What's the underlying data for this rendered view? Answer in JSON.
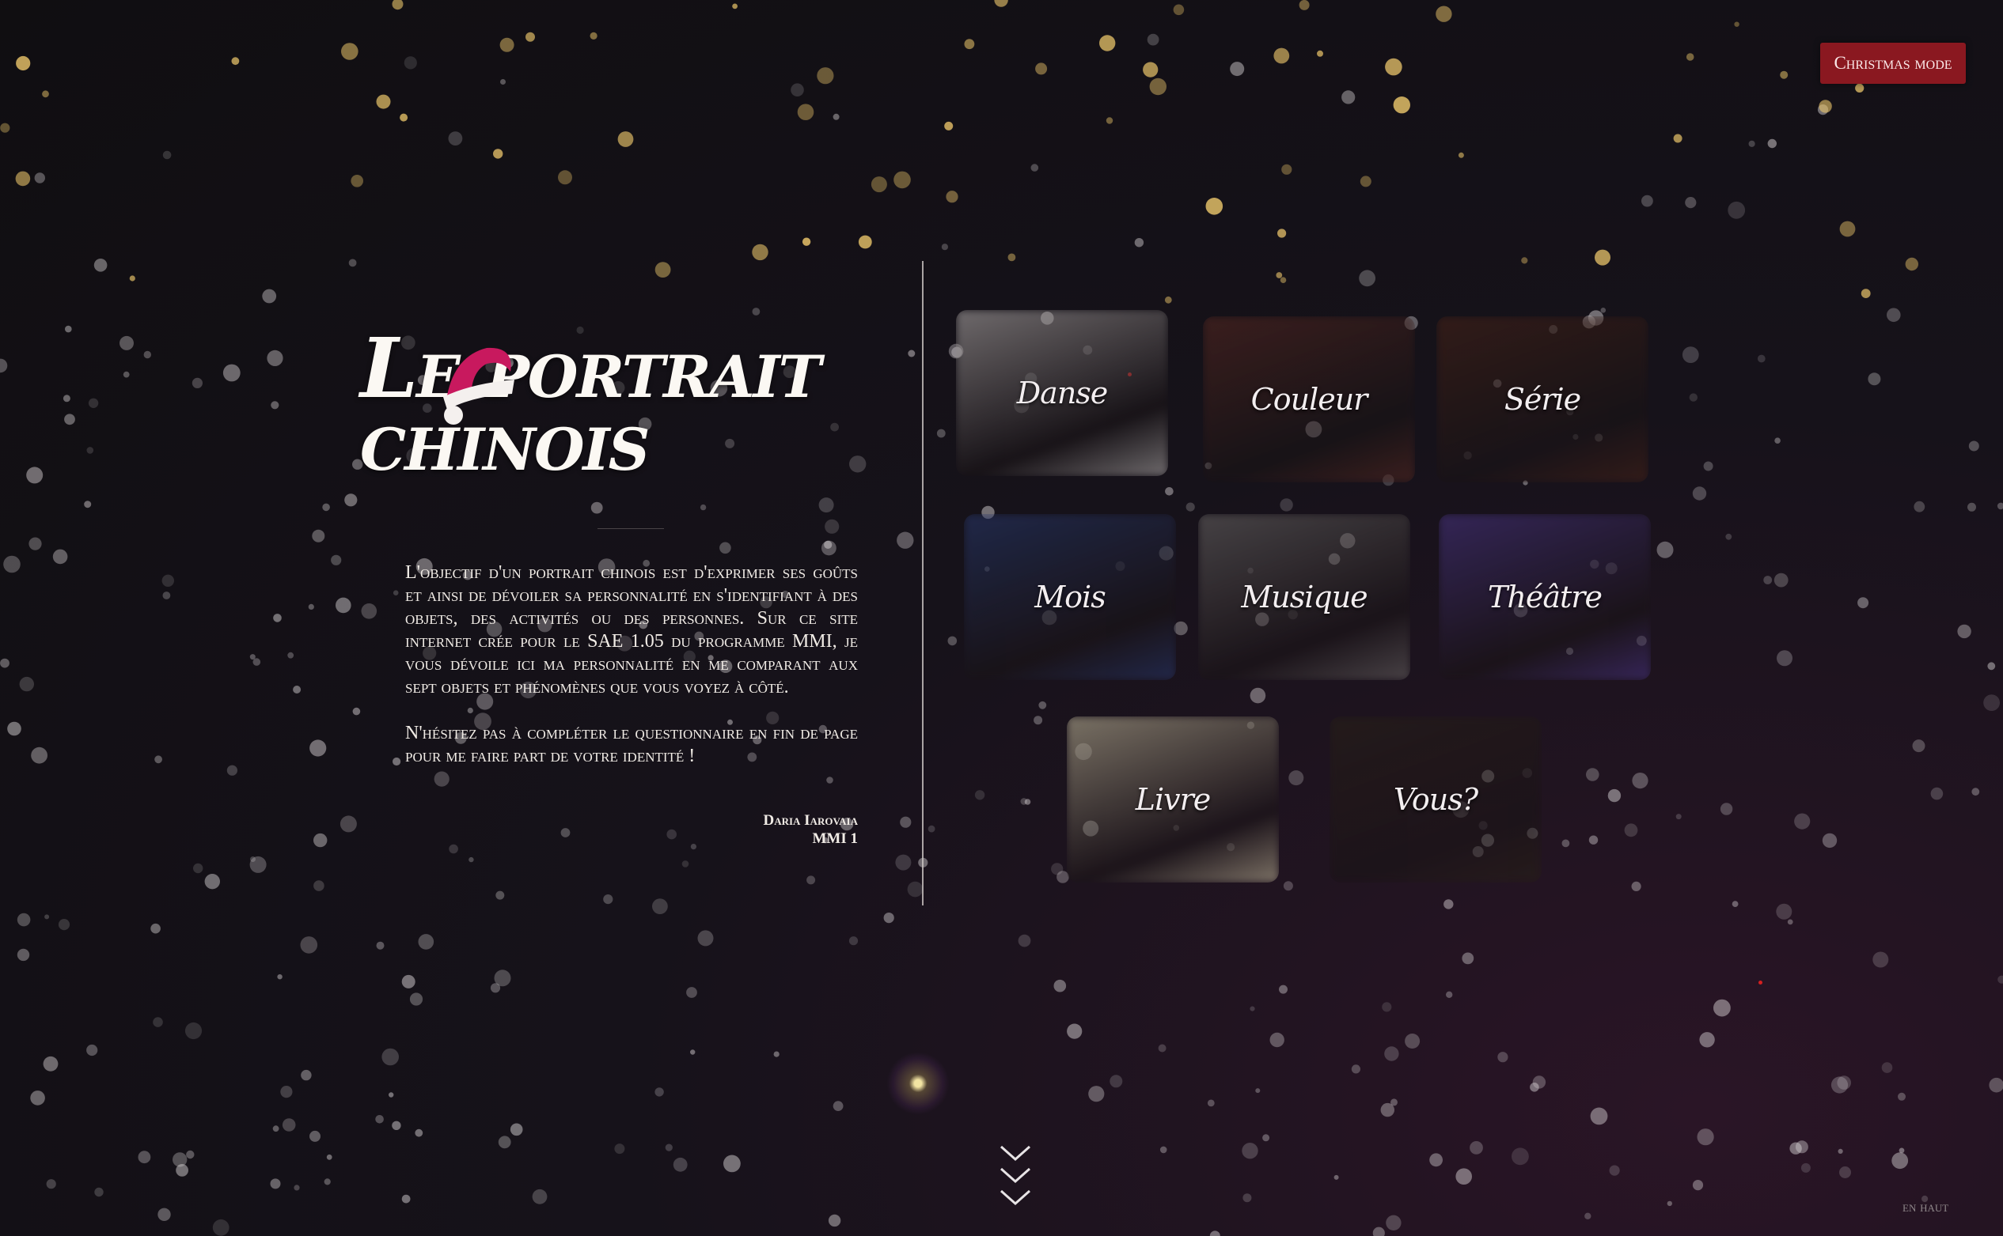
{
  "christmas_button": {
    "label": "Christmas mode"
  },
  "title": {
    "line1": "Le portrait",
    "line2": "chinois"
  },
  "intro": {
    "paragraph1": "L'objectif d'un portrait chinois est d'exprimer ses goûts et ainsi de dévoiler sa personnalité en s'identifiant à des objets, des activités ou des personnes. Sur ce site internet crée pour le SAE 1.05 du programme MMI, je vous dévoile ici ma personnalité en me comparant aux sept objets et phénomènes que vous voyez à côté.",
    "paragraph2": "N'hésitez pas à compléter le questionnaire en fin de page pour me faire part de votre identité !",
    "author": "Daria Iarovaia",
    "group": "MMI 1"
  },
  "gallery": {
    "tiles": [
      {
        "label": "Danse",
        "color": "#b9b4b2"
      },
      {
        "label": "Couleur",
        "color": "#5a2a22"
      },
      {
        "label": "Série",
        "color": "#4a2418"
      },
      {
        "label": "Mois",
        "color": "#2a3a70"
      },
      {
        "label": "Musique",
        "color": "#6e6a68"
      },
      {
        "label": "Théâtre",
        "color": "#4b3688"
      },
      {
        "label": "Livre",
        "color": "#c9c0a0"
      },
      {
        "label": "Vous?",
        "color": "#2a2218"
      }
    ]
  },
  "footer": {
    "to_top_label": "en haut"
  },
  "colors": {
    "accent": "#8a1820",
    "background": "#100e11"
  }
}
